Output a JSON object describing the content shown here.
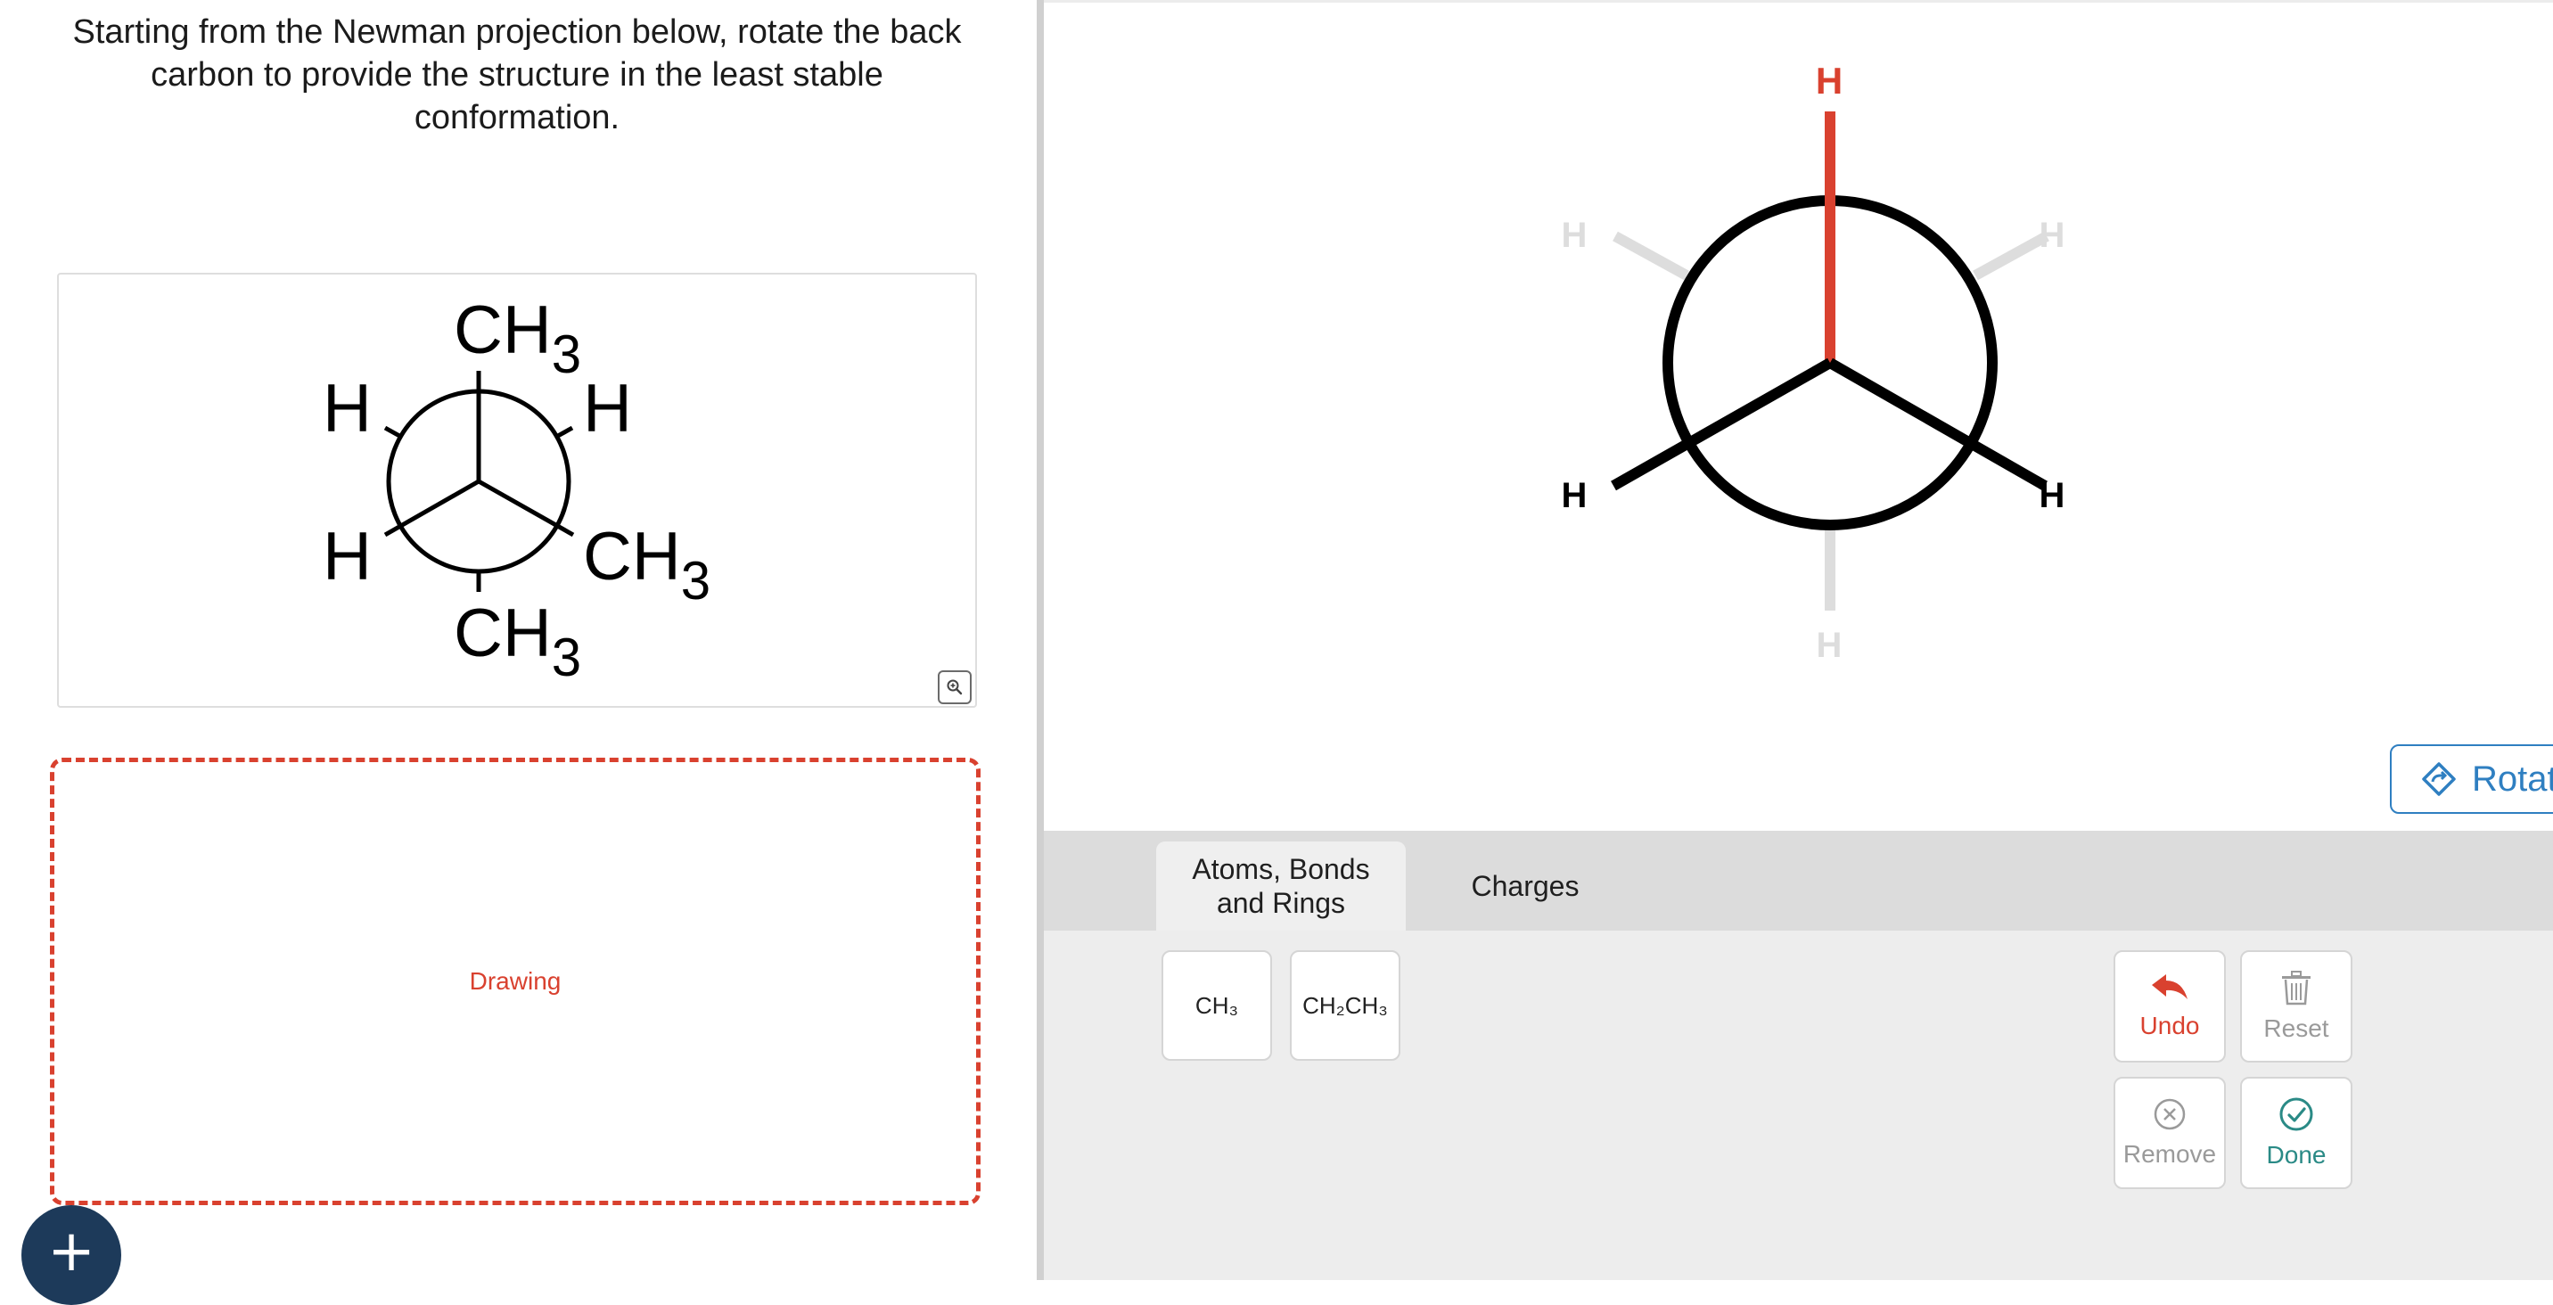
{
  "question": {
    "line1": "Starting from the Newman projection below, rotate the back",
    "line2": "carbon to provide the structure in the least stable",
    "line3": "conformation."
  },
  "given_structure": {
    "top": "CH",
    "top_sub": "3",
    "upper_left": "H",
    "upper_right": "H",
    "lower_left": "H",
    "lower_right": "CH",
    "lower_right_sub": "3",
    "bottom": "CH",
    "bottom_sub": "3"
  },
  "drawing": {
    "label": "Drawing"
  },
  "newman_editor": {
    "front_top": "H",
    "front_left": "H",
    "front_right": "H",
    "back_upper_left": "H",
    "back_upper_right": "H",
    "back_bottom": "H",
    "highlight_color": "#d9412f",
    "ghost_color": "#dddddd"
  },
  "rotate_button": {
    "label": "Rotat"
  },
  "tabs": [
    {
      "label_line1": "Atoms, Bonds",
      "label_line2": "and Rings",
      "active": true
    },
    {
      "label_line1": "Charges",
      "active": false
    }
  ],
  "groups": [
    {
      "label": "CH₃"
    },
    {
      "label": "CH₂CH₃"
    }
  ],
  "actions": {
    "undo": {
      "label": "Undo",
      "icon": "undo-arrow-icon",
      "color": "#d9412f"
    },
    "reset": {
      "label": "Reset",
      "icon": "trash-icon",
      "color": "#9a9a9a"
    },
    "remove": {
      "label": "Remove",
      "icon": "circle-x-icon",
      "color": "#9a9a9a"
    },
    "done": {
      "label": "Done",
      "icon": "circle-check-icon",
      "color": "#2a8a86"
    }
  },
  "add_button": {
    "icon": "plus-icon"
  },
  "zoom_button": {
    "icon": "zoom-in-icon"
  }
}
